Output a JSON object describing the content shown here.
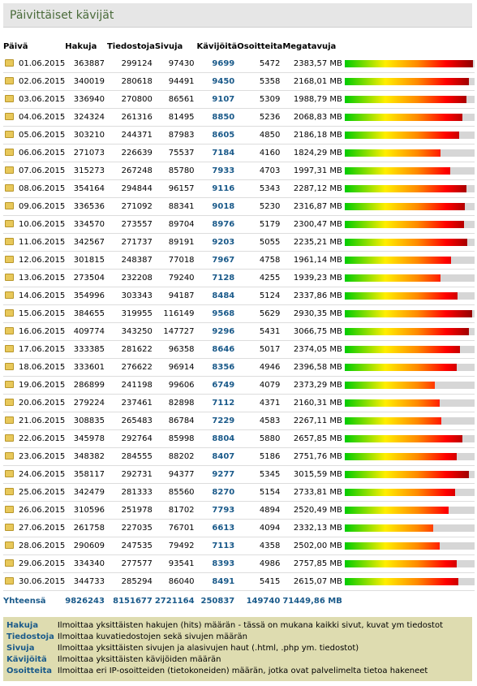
{
  "title": "Päivittäiset kävijät",
  "columns": [
    "Päivä",
    "Hakuja",
    "Tiedostoja",
    "Sivuja",
    "Kävijöitä",
    "Osoitteita",
    "Megatavuja"
  ],
  "max_megatavuja": 3066.75,
  "rows": [
    {
      "paiva": "01.06.2015",
      "hakuja": "363887",
      "tiedostoja": "299124",
      "sivuja": "97430",
      "kavijoita": "9699",
      "osoitteita": "5472",
      "mb": "2383,57 MB",
      "share": 0.99
    },
    {
      "paiva": "02.06.2015",
      "hakuja": "340019",
      "tiedostoja": "280618",
      "sivuja": "94491",
      "kavijoita": "9450",
      "osoitteita": "5358",
      "mb": "2168,01 MB",
      "share": 0.955
    },
    {
      "paiva": "03.06.2015",
      "hakuja": "336940",
      "tiedostoja": "270800",
      "sivuja": "86561",
      "kavijoita": "9107",
      "osoitteita": "5309",
      "mb": "1988,79 MB",
      "share": 0.935
    },
    {
      "paiva": "04.06.2015",
      "hakuja": "324324",
      "tiedostoja": "261316",
      "sivuja": "81495",
      "kavijoita": "8850",
      "osoitteita": "5236",
      "mb": "2068,83 MB",
      "share": 0.905
    },
    {
      "paiva": "05.06.2015",
      "hakuja": "303210",
      "tiedostoja": "244371",
      "sivuja": "87983",
      "kavijoita": "8605",
      "osoitteita": "4850",
      "mb": "2186,18 MB",
      "share": 0.88
    },
    {
      "paiva": "06.06.2015",
      "hakuja": "271073",
      "tiedostoja": "226639",
      "sivuja": "75537",
      "kavijoita": "7184",
      "osoitteita": "4160",
      "mb": "1824,29 MB",
      "share": 0.735
    },
    {
      "paiva": "07.06.2015",
      "hakuja": "315273",
      "tiedostoja": "267248",
      "sivuja": "85780",
      "kavijoita": "7933",
      "osoitteita": "4703",
      "mb": "1997,31 MB",
      "share": 0.815
    },
    {
      "paiva": "08.06.2015",
      "hakuja": "354164",
      "tiedostoja": "294844",
      "sivuja": "96157",
      "kavijoita": "9116",
      "osoitteita": "5343",
      "mb": "2287,12 MB",
      "share": 0.935
    },
    {
      "paiva": "09.06.2015",
      "hakuja": "336536",
      "tiedostoja": "271092",
      "sivuja": "88341",
      "kavijoita": "9018",
      "osoitteita": "5230",
      "mb": "2316,87 MB",
      "share": 0.925
    },
    {
      "paiva": "10.06.2015",
      "hakuja": "334570",
      "tiedostoja": "273557",
      "sivuja": "89704",
      "kavijoita": "8976",
      "osoitteita": "5179",
      "mb": "2300,47 MB",
      "share": 0.92
    },
    {
      "paiva": "11.06.2015",
      "hakuja": "342567",
      "tiedostoja": "271737",
      "sivuja": "89191",
      "kavijoita": "9203",
      "osoitteita": "5055",
      "mb": "2235,21 MB",
      "share": 0.945
    },
    {
      "paiva": "12.06.2015",
      "hakuja": "301815",
      "tiedostoja": "248387",
      "sivuja": "77018",
      "kavijoita": "7967",
      "osoitteita": "4758",
      "mb": "1961,14 MB",
      "share": 0.82
    },
    {
      "paiva": "13.06.2015",
      "hakuja": "273504",
      "tiedostoja": "232208",
      "sivuja": "79240",
      "kavijoita": "7128",
      "osoitteita": "4255",
      "mb": "1939,23 MB",
      "share": 0.735
    },
    {
      "paiva": "14.06.2015",
      "hakuja": "354996",
      "tiedostoja": "303343",
      "sivuja": "94187",
      "kavijoita": "8484",
      "osoitteita": "5124",
      "mb": "2337,86 MB",
      "share": 0.87
    },
    {
      "paiva": "15.06.2015",
      "hakuja": "384655",
      "tiedostoja": "319955",
      "sivuja": "116149",
      "kavijoita": "9568",
      "osoitteita": "5629",
      "mb": "2930,35 MB",
      "share": 0.98
    },
    {
      "paiva": "16.06.2015",
      "hakuja": "409774",
      "tiedostoja": "343250",
      "sivuja": "147727",
      "kavijoita": "9296",
      "osoitteita": "5431",
      "mb": "3066,75 MB",
      "share": 0.955
    },
    {
      "paiva": "17.06.2015",
      "hakuja": "333385",
      "tiedostoja": "281622",
      "sivuja": "96358",
      "kavijoita": "8646",
      "osoitteita": "5017",
      "mb": "2374,05 MB",
      "share": 0.89
    },
    {
      "paiva": "18.06.2015",
      "hakuja": "333601",
      "tiedostoja": "276622",
      "sivuja": "96914",
      "kavijoita": "8356",
      "osoitteita": "4946",
      "mb": "2396,58 MB",
      "share": 0.86
    },
    {
      "paiva": "19.06.2015",
      "hakuja": "286899",
      "tiedostoja": "241198",
      "sivuja": "99606",
      "kavijoita": "6749",
      "osoitteita": "4079",
      "mb": "2373,29 MB",
      "share": 0.695
    },
    {
      "paiva": "20.06.2015",
      "hakuja": "279224",
      "tiedostoja": "237461",
      "sivuja": "82898",
      "kavijoita": "7112",
      "osoitteita": "4371",
      "mb": "2160,31 MB",
      "share": 0.73
    },
    {
      "paiva": "21.06.2015",
      "hakuja": "308835",
      "tiedostoja": "265483",
      "sivuja": "86784",
      "kavijoita": "7229",
      "osoitteita": "4583",
      "mb": "2267,11 MB",
      "share": 0.745
    },
    {
      "paiva": "22.06.2015",
      "hakuja": "345978",
      "tiedostoja": "292764",
      "sivuja": "85998",
      "kavijoita": "8804",
      "osoitteita": "5880",
      "mb": "2657,85 MB",
      "share": 0.905
    },
    {
      "paiva": "23.06.2015",
      "hakuja": "348382",
      "tiedostoja": "284555",
      "sivuja": "88202",
      "kavijoita": "8407",
      "osoitteita": "5186",
      "mb": "2751,76 MB",
      "share": 0.865
    },
    {
      "paiva": "24.06.2015",
      "hakuja": "358117",
      "tiedostoja": "292731",
      "sivuja": "94377",
      "kavijoita": "9277",
      "osoitteita": "5345",
      "mb": "3015,59 MB",
      "share": 0.955
    },
    {
      "paiva": "25.06.2015",
      "hakuja": "342479",
      "tiedostoja": "281333",
      "sivuja": "85560",
      "kavijoita": "8270",
      "osoitteita": "5154",
      "mb": "2733,81 MB",
      "share": 0.85
    },
    {
      "paiva": "26.06.2015",
      "hakuja": "310596",
      "tiedostoja": "251978",
      "sivuja": "81702",
      "kavijoita": "7793",
      "osoitteita": "4894",
      "mb": "2520,49 MB",
      "share": 0.8
    },
    {
      "paiva": "27.06.2015",
      "hakuja": "261758",
      "tiedostoja": "227035",
      "sivuja": "76701",
      "kavijoita": "6613",
      "osoitteita": "4094",
      "mb": "2332,13 MB",
      "share": 0.68
    },
    {
      "paiva": "28.06.2015",
      "hakuja": "290609",
      "tiedostoja": "247535",
      "sivuja": "79492",
      "kavijoita": "7113",
      "osoitteita": "4358",
      "mb": "2502,00 MB",
      "share": 0.73
    },
    {
      "paiva": "29.06.2015",
      "hakuja": "334340",
      "tiedostoja": "277577",
      "sivuja": "93541",
      "kavijoita": "8393",
      "osoitteita": "4986",
      "mb": "2757,85 MB",
      "share": 0.865
    },
    {
      "paiva": "30.06.2015",
      "hakuja": "344733",
      "tiedostoja": "285294",
      "sivuja": "86040",
      "kavijoita": "8491",
      "osoitteita": "5415",
      "mb": "2615,07 MB",
      "share": 0.875
    }
  ],
  "totals": {
    "label": "Yhteensä",
    "hakuja": "9826243",
    "tiedostoja": "8151677",
    "sivuja": "2721164",
    "kavijoita": "250837",
    "osoitteita": "149740",
    "mb": "71449,86 MB"
  },
  "legend": [
    {
      "term": "Hakuja",
      "desc": "Ilmoittaa yksittäisten hakujen (hits) määrän - tässä on mukana kaikki sivut, kuvat ym tiedostot"
    },
    {
      "term": "Tiedostoja",
      "desc": "Ilmoittaa kuvatiedostojen sekä sivujen määrän"
    },
    {
      "term": "Sivuja",
      "desc": "Ilmoittaa yksittäisten sivujen ja alasivujen haut (.html, .php ym. tiedostot)"
    },
    {
      "term": "Kävijöitä",
      "desc": "Ilmoittaa yksittäisten kävijöiden määrän"
    },
    {
      "term": "Osoitteita",
      "desc": "Ilmoittaa eri IP-osoitteiden (tietokoneiden) määrän, jotka ovat palvelimelta tietoa hakeneet"
    }
  ],
  "colors": {
    "accent": "#1a5a8a",
    "title": "#4a6b3a",
    "legend_bg": "#dedcb0"
  },
  "icons": {
    "row": "folder-icon"
  }
}
